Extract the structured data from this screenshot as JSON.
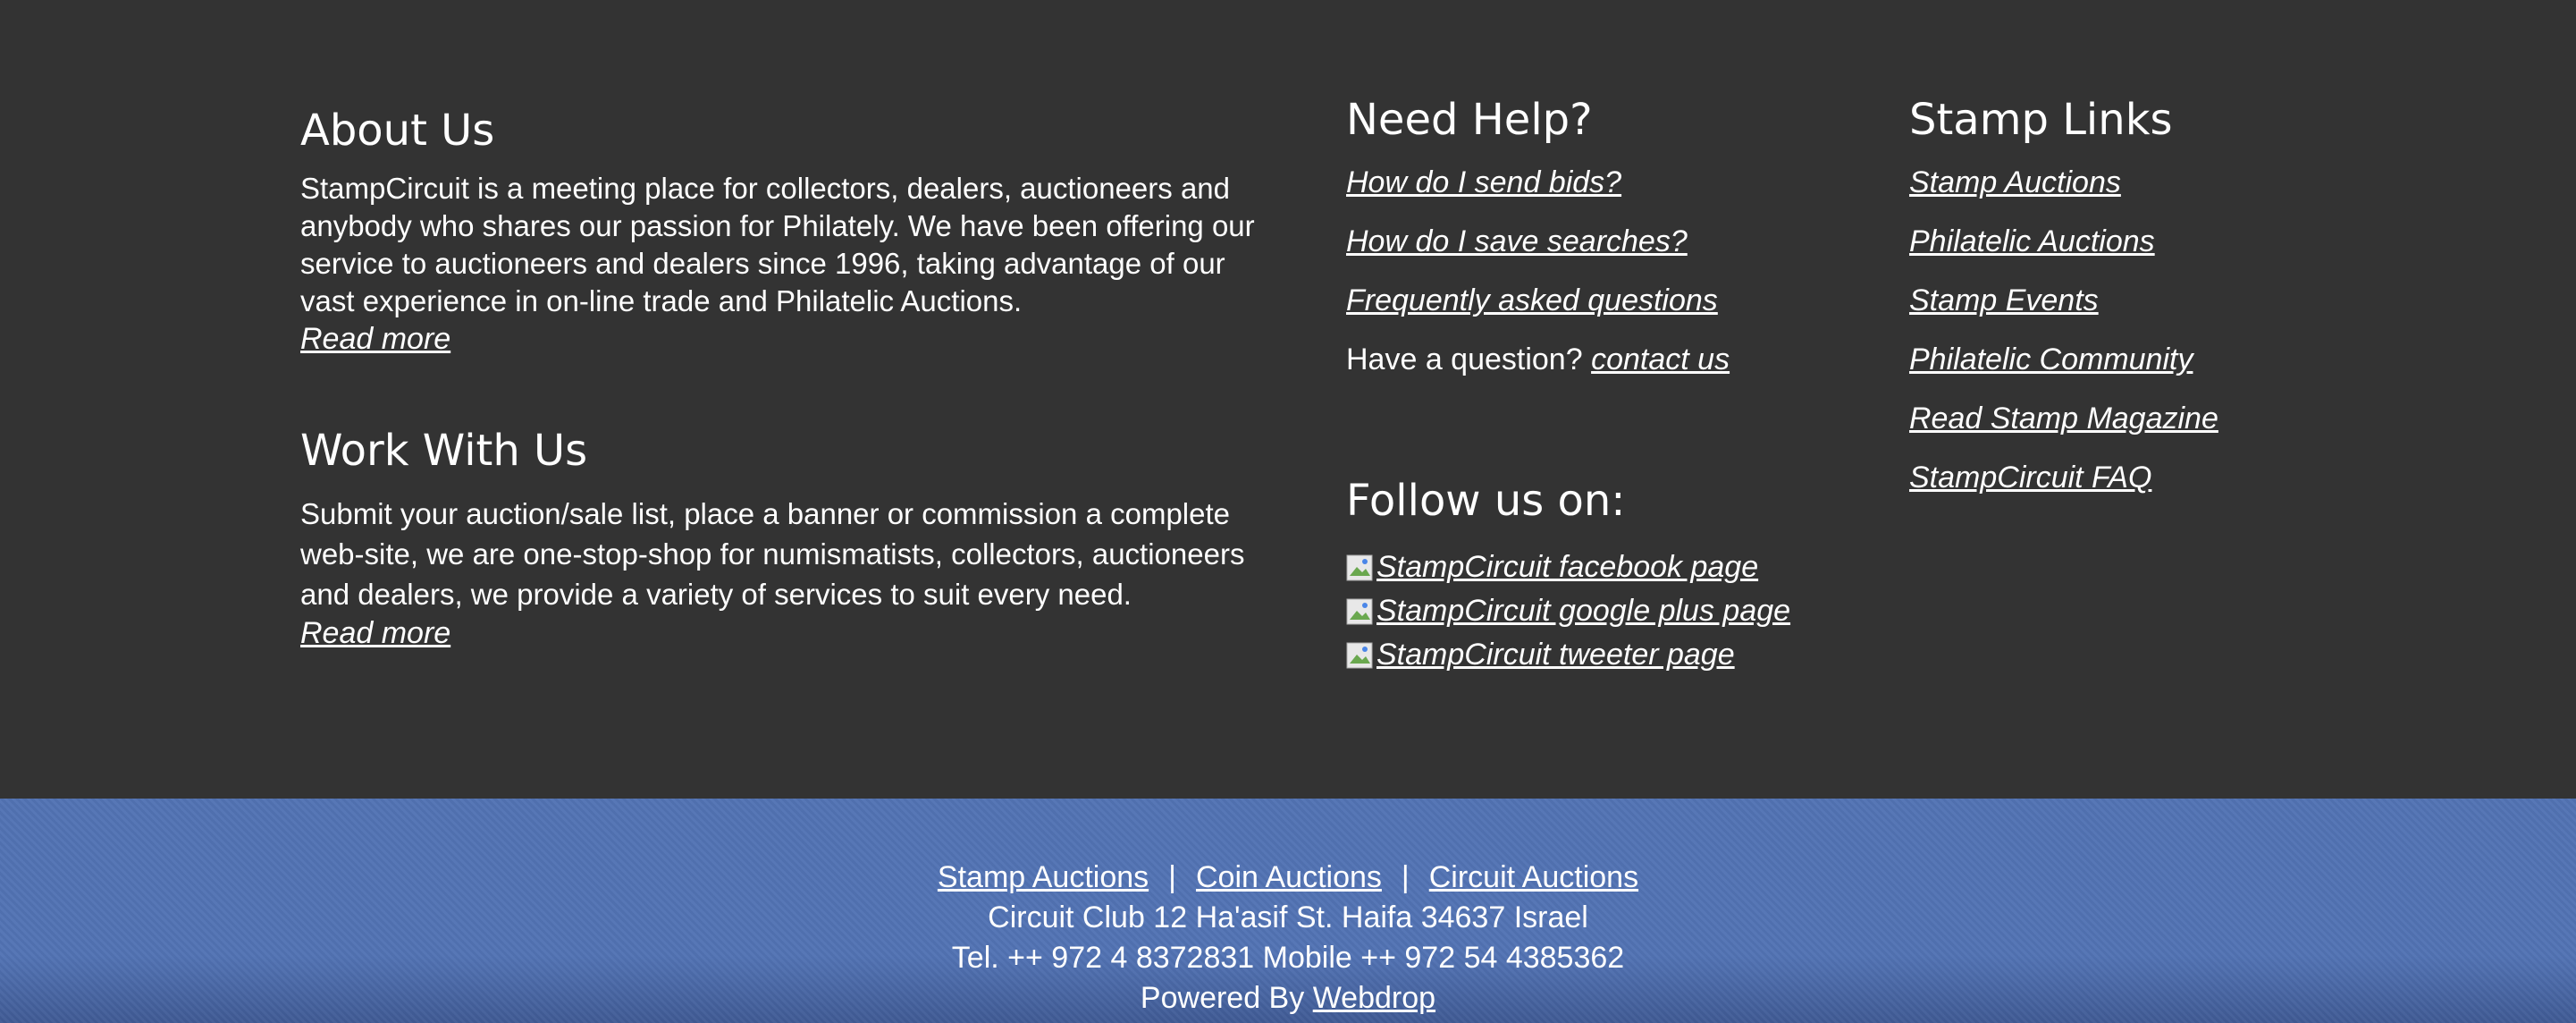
{
  "about": {
    "title": "About Us",
    "text": "StampCircuit is a meeting place for collectors, dealers, auctioneers and anybody who shares our passion for Philately. We have been offering our service to auctioneers and dealers since 1996, taking advantage of our vast experience in on-line trade and Philatelic Auctions.",
    "read_more": "Read more"
  },
  "work": {
    "title": "Work With Us",
    "text": "Submit your auction/sale list, place a banner or commission a complete web-site, we are one-stop-shop for numismatists, collectors, auctioneers and dealers, we provide a variety of services to suit every need.",
    "read_more": "Read more"
  },
  "help": {
    "title": "Need Help?",
    "links": [
      "How do I send bids?",
      "How do I save searches?",
      "Frequently asked questions"
    ],
    "question_text": "Have a question?",
    "contact_label": "contact us"
  },
  "follow": {
    "title": "Follow us on:",
    "items": [
      {
        "label": "StampCircuit facebook page",
        "icon": "broken-image-icon"
      },
      {
        "label": "StampCircuit google plus page",
        "icon": "broken-image-icon"
      },
      {
        "label": "StampCircuit tweeter page",
        "icon": "broken-image-icon"
      }
    ]
  },
  "stamp_links": {
    "title": "Stamp Links",
    "links": [
      "Stamp Auctions",
      "Philatelic Auctions",
      "Stamp Events",
      "Philatelic Community",
      "Read Stamp Magazine",
      "StampCircuit FAQ"
    ]
  },
  "bottom": {
    "nav": [
      "Stamp Auctions",
      "Coin Auctions",
      "Circuit Auctions"
    ],
    "separator": "|",
    "address": "Circuit Club 12 Ha'asif St. Haifa 34637 Israel",
    "phone": "Tel. ++ 972 4 8372831 Mobile ++ 972 54 4385362",
    "powered_by": "Powered By",
    "powered_link": "Webdrop"
  },
  "colors": {
    "top_bg": "#333333",
    "bottom_bg": "#5273b4",
    "text": "#ffffff"
  }
}
